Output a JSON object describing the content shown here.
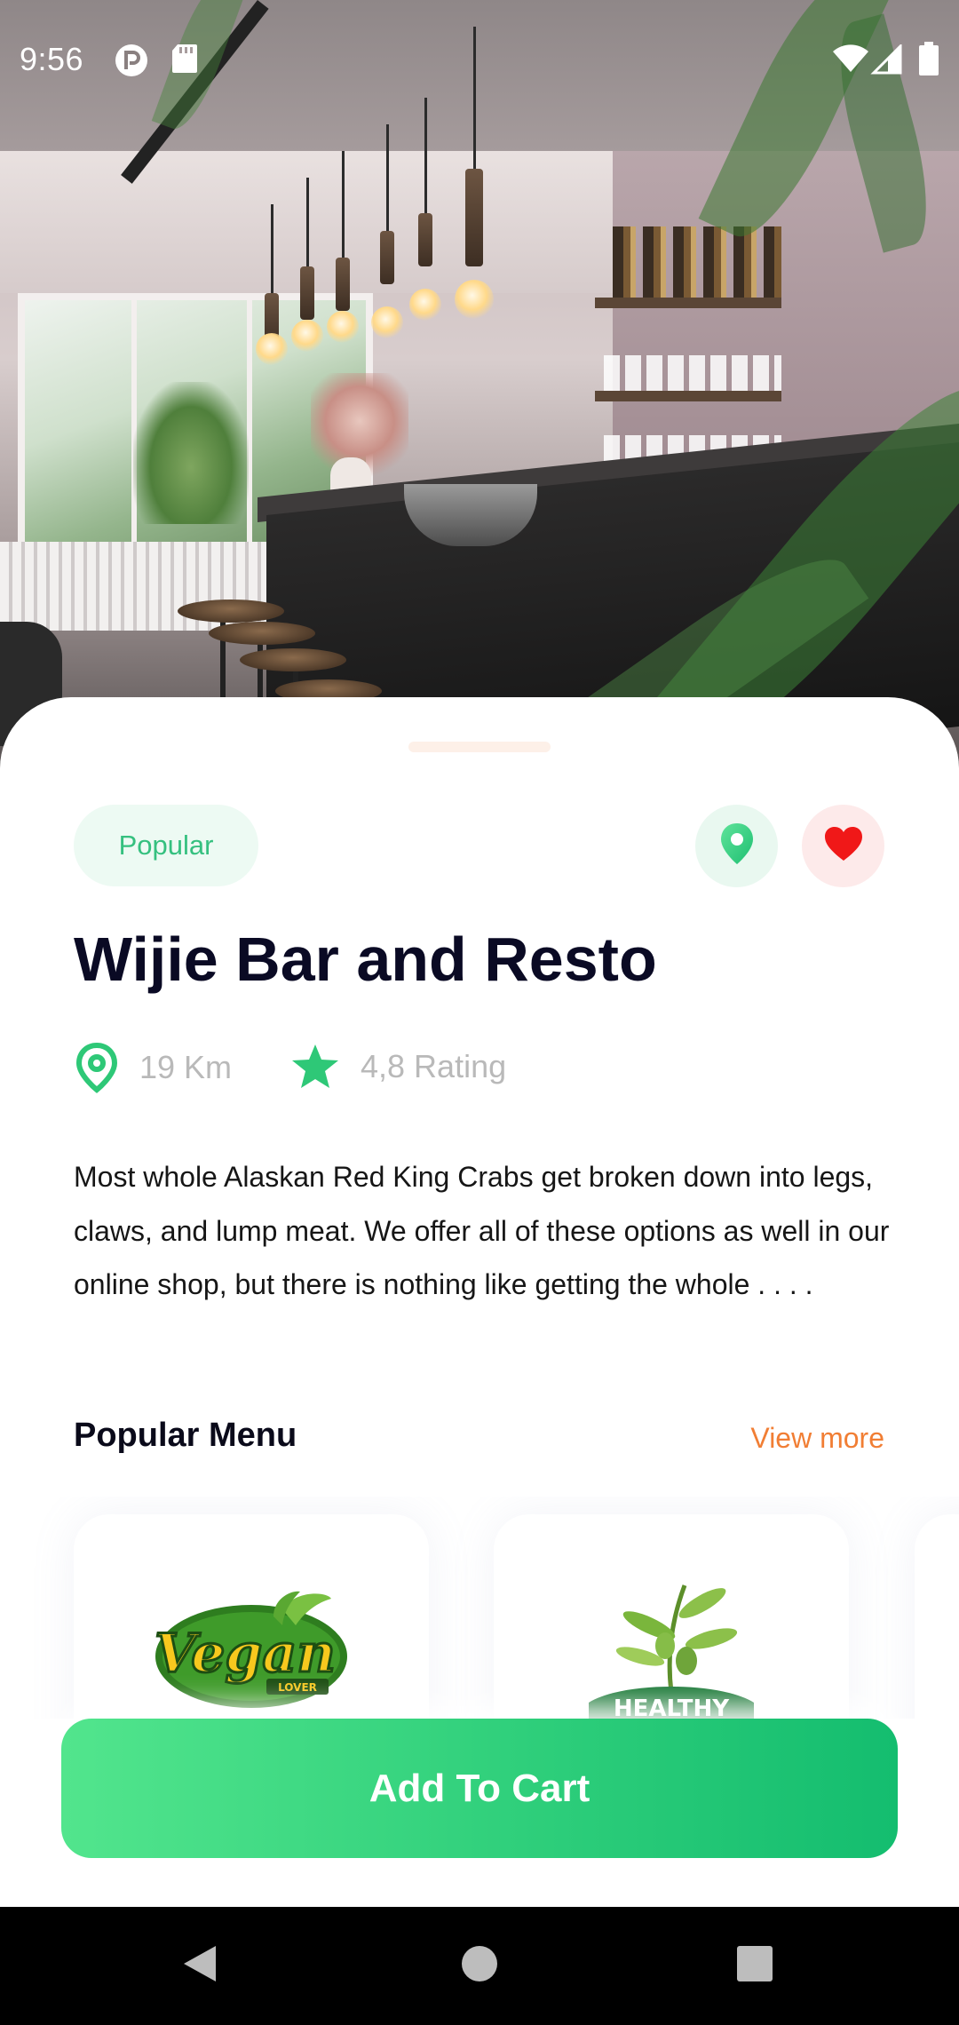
{
  "status_bar": {
    "time": "9:56"
  },
  "restaurant": {
    "tag": "Popular",
    "name": "Wijie Bar and Resto",
    "distance": "19 Km",
    "rating": "4,8 Rating",
    "description": "Most whole Alaskan Red King Crabs get broken down into legs, claws, and lump meat. We offer all of these options as well in our online shop, but there is nothing like getting the whole . . . ."
  },
  "popular_menu": {
    "title": "Popular Menu",
    "view_more": "View more",
    "items": [
      {
        "logo_text": "Vegan",
        "logo_subtext": "LOVER",
        "icon": "vegan-lover-logo"
      },
      {
        "logo_text": "HEALTHY",
        "icon": "healthy-olive-logo"
      }
    ]
  },
  "cta": {
    "label": "Add To Cart"
  },
  "colors": {
    "accent_green": "#35c07f",
    "accent_orange": "#f17e34",
    "favorite_red": "#f01818",
    "title_dark": "#0a0a24"
  },
  "icons": {
    "location_button": "map-pin-icon",
    "favorite_button": "heart-icon",
    "distance": "map-pin-outline-icon",
    "rating": "star-icon"
  }
}
